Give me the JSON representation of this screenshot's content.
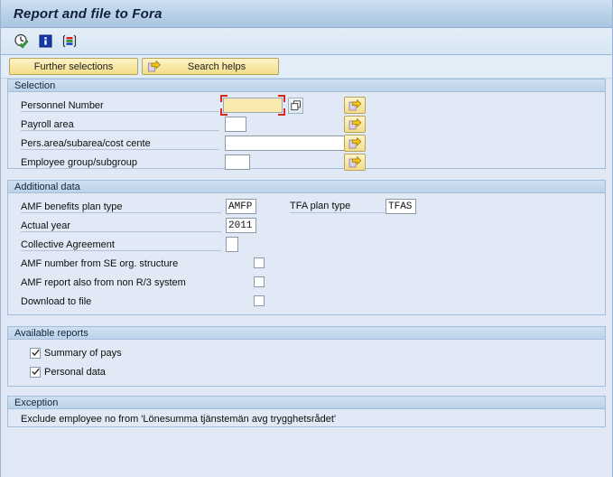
{
  "window": {
    "title": "Report and file to Fora"
  },
  "toolbar": {
    "icons": [
      {
        "name": "execute-clock-icon",
        "title": "Execute"
      },
      {
        "name": "info-icon",
        "title": "Information"
      },
      {
        "name": "variant-list-icon",
        "title": "Get variant"
      }
    ]
  },
  "buttons": {
    "further_selections": "Further selections",
    "search_helps": "Search helps"
  },
  "selection": {
    "header": "Selection",
    "fields": [
      {
        "label": "Personnel Number",
        "value": "",
        "focused": true,
        "has_matchcode": true
      },
      {
        "label": "Payroll area",
        "value": "",
        "focused": false,
        "has_matchcode": false
      },
      {
        "label": "Pers.area/subarea/cost cente",
        "value": "",
        "focused": false,
        "has_matchcode": false
      },
      {
        "label": "Employee group/subgroup",
        "value": "",
        "focused": false,
        "has_matchcode": false
      }
    ]
  },
  "additional_data": {
    "header": "Additional data",
    "fields": [
      {
        "label": "AMF benefits plan type",
        "value": "AMFP"
      },
      {
        "label": "Actual year",
        "value": "2011"
      },
      {
        "label": "Collective Agreement",
        "value": ""
      }
    ],
    "right_field": {
      "label": "TFA plan type",
      "value": "TFAS"
    },
    "checkboxes": [
      {
        "label": "AMF number from SE org. structure",
        "checked": false
      },
      {
        "label": "AMF report also from non R/3 system",
        "checked": false
      },
      {
        "label": "Download to file",
        "checked": false
      }
    ]
  },
  "available_reports": {
    "header": "Available reports",
    "checkboxes": [
      {
        "label": "Summary of pays",
        "checked": true
      },
      {
        "label": "Personal data",
        "checked": true
      }
    ]
  },
  "exception": {
    "header": "Exception",
    "text": "Exclude employee no from 'Lönesumma tjänstemän avg trygghetsrådet'"
  },
  "colors": {
    "accent": "#a9c5e0",
    "panel_bg": "#e0e9f5",
    "button_yellow": "#f7e7a2",
    "focus_red": "#d52b1e"
  }
}
